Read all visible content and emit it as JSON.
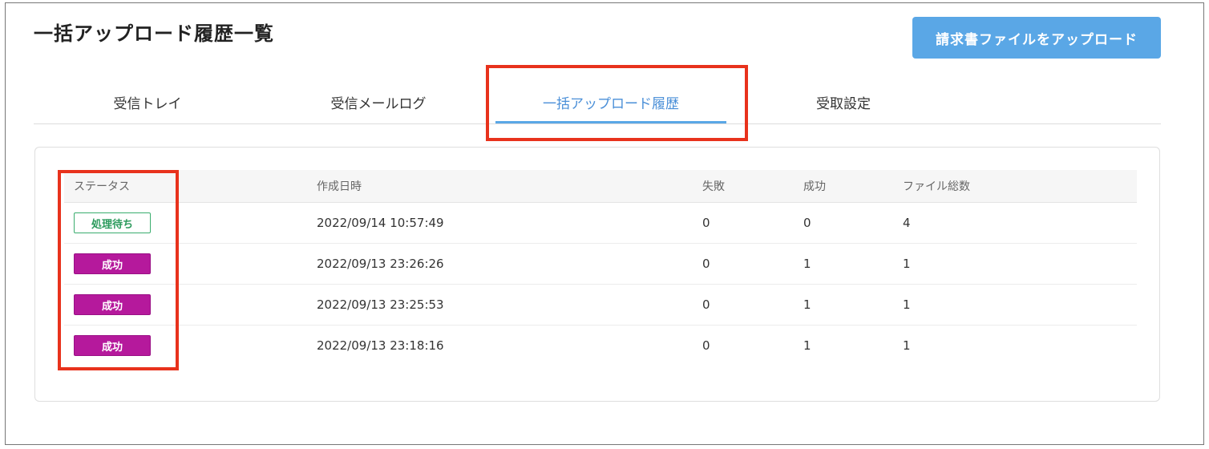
{
  "header": {
    "title": "一括アップロード履歴一覧",
    "upload_button_label": "請求書ファイルをアップロード"
  },
  "tabs": [
    {
      "label": "受信トレイ",
      "active": false
    },
    {
      "label": "受信メールログ",
      "active": false
    },
    {
      "label": "一括アップロード履歴",
      "active": true
    },
    {
      "label": "受取設定",
      "active": false
    }
  ],
  "table": {
    "columns": [
      "ステータス",
      "作成日時",
      "失敗",
      "成功",
      "ファイル総数"
    ],
    "rows": [
      {
        "status": "処理待ち",
        "status_type": "pending",
        "created_at": "2022/09/14 10:57:49",
        "failed": "0",
        "succeeded": "0",
        "total": "4"
      },
      {
        "status": "成功",
        "status_type": "success",
        "created_at": "2022/09/13 23:26:26",
        "failed": "0",
        "succeeded": "1",
        "total": "1"
      },
      {
        "status": "成功",
        "status_type": "success",
        "created_at": "2022/09/13 23:25:53",
        "failed": "0",
        "succeeded": "1",
        "total": "1"
      },
      {
        "status": "成功",
        "status_type": "success",
        "created_at": "2022/09/13 23:18:16",
        "failed": "0",
        "succeeded": "1",
        "total": "1"
      }
    ]
  },
  "colors": {
    "accent": "#5aa7e6",
    "annotation": "#e8321c",
    "pending": "#3aad6e",
    "success": "#b5199c"
  }
}
